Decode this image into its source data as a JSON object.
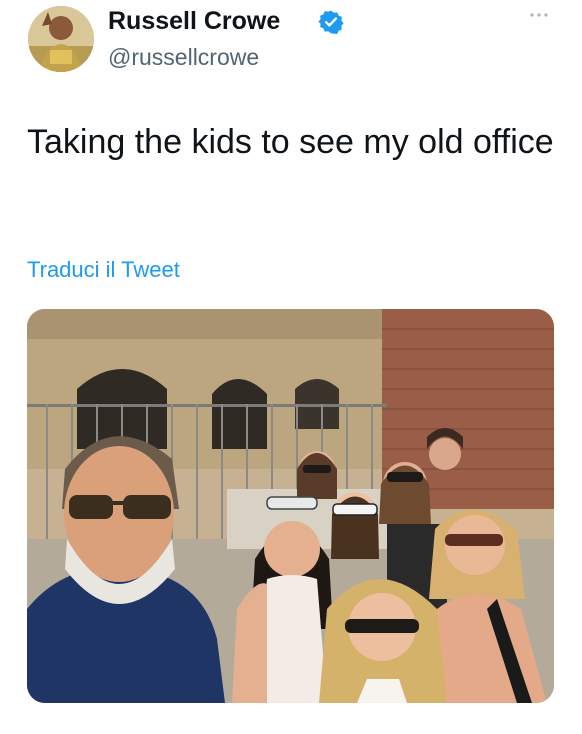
{
  "author": {
    "display_name": "Russell Crowe",
    "handle": "@russellcrowe",
    "verified": true,
    "avatar_icon": "avatar-photo"
  },
  "tweet": {
    "text": "Taking the kids to see my old office",
    "translate_label": "Traduci il Tweet"
  },
  "media": {
    "type": "photo",
    "alt_icon": "photo-image"
  },
  "colors": {
    "link": "#1d9bf0",
    "verified": "#1d9bf0",
    "secondary_text": "#536471",
    "primary_text": "#0f1419"
  }
}
